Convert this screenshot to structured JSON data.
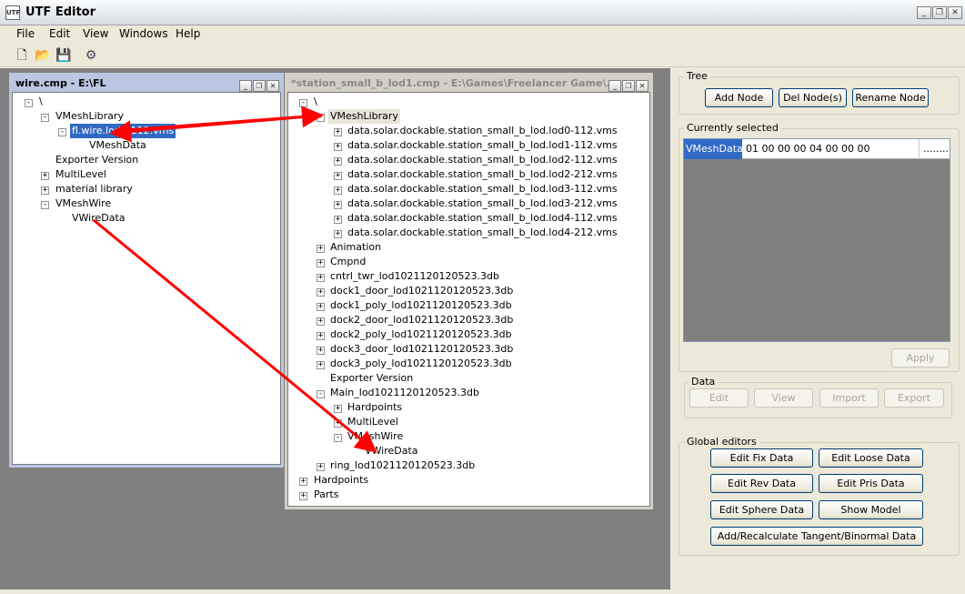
{
  "app": {
    "title": "UTF Editor",
    "icon_text": "UTF"
  },
  "menu": [
    "File",
    "Edit",
    "View",
    "Windows",
    "Help"
  ],
  "toolbar": {
    "icons": [
      "new-file-icon",
      "open-folder-icon",
      "save-icon",
      "settings-icon"
    ]
  },
  "left_window": {
    "title": "wire.cmp - E:\\FL",
    "nodes": [
      "\\",
      "VMeshLibrary",
      "fl.wire.lod0-112.vms",
      "VMeshData",
      "Exporter Version",
      "MultiLevel",
      "material library",
      "VMeshWire",
      "VWireData"
    ]
  },
  "right_window": {
    "title": "*station_small_b_lod1.cmp - E:\\Games\\Freelancer Game\\...",
    "nodes": [
      "\\",
      "VMeshLibrary",
      "data.solar.dockable.station_small_b_lod.lod0-112.vms",
      "data.solar.dockable.station_small_b_lod.lod1-112.vms",
      "data.solar.dockable.station_small_b_lod.lod2-112.vms",
      "data.solar.dockable.station_small_b_lod.lod2-212.vms",
      "data.solar.dockable.station_small_b_lod.lod3-112.vms",
      "data.solar.dockable.station_small_b_lod.lod3-212.vms",
      "data.solar.dockable.station_small_b_lod.lod4-112.vms",
      "data.solar.dockable.station_small_b_lod.lod4-212.vms",
      "Animation",
      "Cmpnd",
      "cntrl_twr_lod1021120120523.3db",
      "dock1_door_lod1021120120523.3db",
      "dock1_poly_lod1021120120523.3db",
      "dock2_door_lod1021120120523.3db",
      "dock2_poly_lod1021120120523.3db",
      "dock3_door_lod1021120120523.3db",
      "dock3_poly_lod1021120120523.3db",
      "Exporter Version",
      "Main_lod1021120120523.3db",
      "Hardpoints",
      "MultiLevel",
      "VMeshWire",
      "VWireData",
      "ring_lod1021120120523.3db",
      "Hardpoints",
      "Parts"
    ]
  },
  "panel": {
    "tree_label": "Tree",
    "add_node": "Add Node",
    "del_node": "Del Node(s)",
    "rename_node": "Rename Node",
    "current_label": "Currently selected",
    "current_name": "VMeshData",
    "current_value": "01 00 00 00 04 00 00 00",
    "current_more": "........",
    "apply": "Apply",
    "data_label": "Data",
    "data_buttons": [
      "Edit",
      "View",
      "Import",
      "Export"
    ],
    "global_label": "Global editors",
    "global_buttons": [
      "Edit Fix Data",
      "Edit Loose Data",
      "Edit Rev Data",
      "Edit Pris Data",
      "Edit Sphere Data",
      "Show Model",
      "Add/Recalculate Tangent/Binormal Data"
    ]
  },
  "colors": {
    "selection": "#316ac5",
    "arrow": "#ff0000",
    "mdi_bg": "#808080"
  }
}
